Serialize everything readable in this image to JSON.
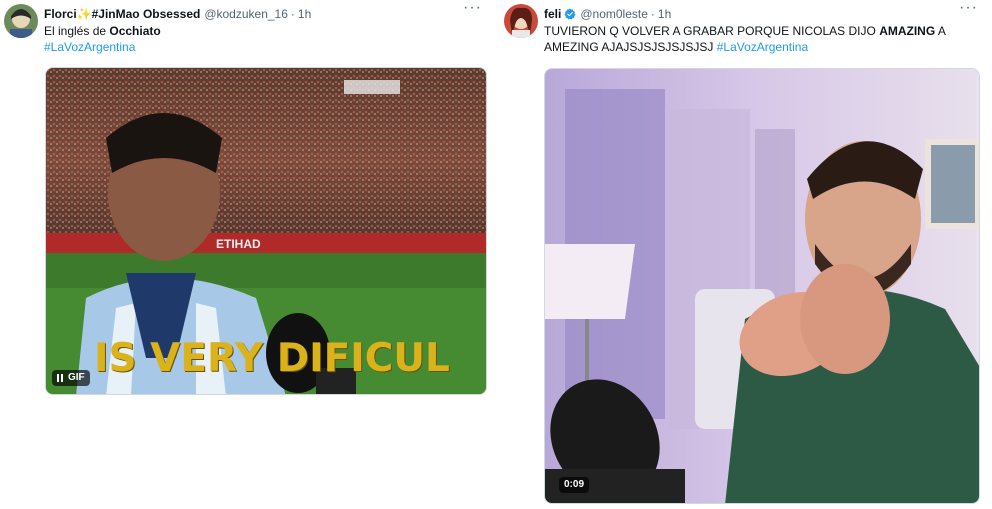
{
  "tweets": [
    {
      "name": "Florci✨#JinMao Obsessed",
      "handle": "@kodzuken_16",
      "dot": "·",
      "time": "1h",
      "more": "···",
      "text_prefix": "El inglés de ",
      "text_bold": "Occhiato",
      "hashtag": "#LaVozArgentina",
      "media": {
        "caption": "IS VERY DIFICUL",
        "badge": "GIF"
      }
    },
    {
      "name": "feli",
      "handle": "@nom0leste",
      "dot": "·",
      "time": "1h",
      "more": "···",
      "text_prefix": "TUVIERON Q VOLVER A GRABAR PORQUE NICOLAS DIJO ",
      "text_bold": "AMAZING",
      "text_suffix": " A AMEZING AJAJSJSJSJSJSJSJ ",
      "hashtag": "#LaVozArgentina",
      "media": {
        "duration": "0:09"
      }
    }
  ],
  "colors": {
    "link": "#1d9bf0",
    "secondary": "#536471",
    "verified": "#1d9bf0",
    "caption": "#d9b21c"
  },
  "icons": [
    "avatar",
    "sparkles",
    "verified-badge-icon",
    "more-icon",
    "pause-icon"
  ]
}
